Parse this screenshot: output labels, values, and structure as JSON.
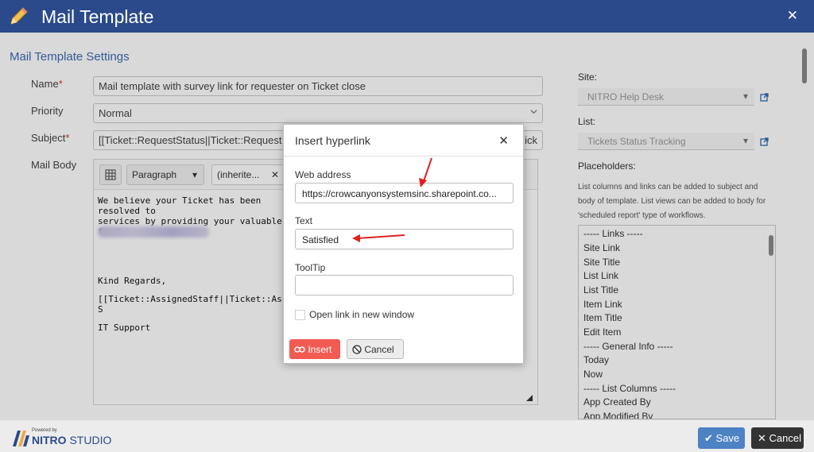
{
  "window": {
    "title": "Mail Template"
  },
  "form": {
    "section_title": "Mail Template Settings",
    "name_label": "Name",
    "name_value": "Mail template with survey link for requester on Ticket close",
    "priority_label": "Priority",
    "priority_value": "Normal",
    "subject_label": "Subject",
    "subject_value": "[[Ticket::RequestStatus||Ticket::Request Sta",
    "subject_tail": "ick",
    "body_label": "Mail Body",
    "required_mark": "*"
  },
  "editor": {
    "format_select": "Paragraph",
    "font_select": "(inherite...",
    "body_lines": [
      "We believe your Ticket has been resolved to",
      "services by providing your valuable feedbac",
      "Kind Regards,",
      "[[Ticket::AssignedStaff||Ticket::Assigned S",
      "IT Support"
    ]
  },
  "sidebar": {
    "site_label": "Site:",
    "site_value": "NITRO Help Desk",
    "list_label": "List:",
    "list_value": "Tickets Status Tracking",
    "placeholders_label": "Placeholders:",
    "placeholders_desc": "List columns and links can be added to subject and body of template. List views can be added to body for 'scheduled report' type of workflows.",
    "placeholders": [
      "----- Links -----",
      "Site Link",
      "Site Title",
      "List Link",
      "List Title",
      "Item Link",
      "Item Title",
      "Edit Item",
      "----- General Info -----",
      "Today",
      "Now",
      "----- List Columns -----",
      "App Created By",
      "App Modified By"
    ]
  },
  "dialog": {
    "title": "Insert hyperlink",
    "web_address_label": "Web address",
    "web_address_value": "https://crowcanyonsystemsinc.sharepoint.co...",
    "text_label": "Text",
    "text_value": "Satisfied",
    "tooltip_label": "ToolTip",
    "tooltip_value": "",
    "new_window_label": "Open link in new window",
    "insert_label": "Insert",
    "cancel_label": "Cancel"
  },
  "footer": {
    "powered_by": "Powered by",
    "brand_bold": "NITRO",
    "brand_thin": "STUDIO",
    "save_label": "Save",
    "cancel_label": "Cancel"
  },
  "colors": {
    "titlebar": "#2b4a8b",
    "accent": "#3c6cb4",
    "insert_button": "#f15b52",
    "annotation_arrow": "#e02020"
  }
}
